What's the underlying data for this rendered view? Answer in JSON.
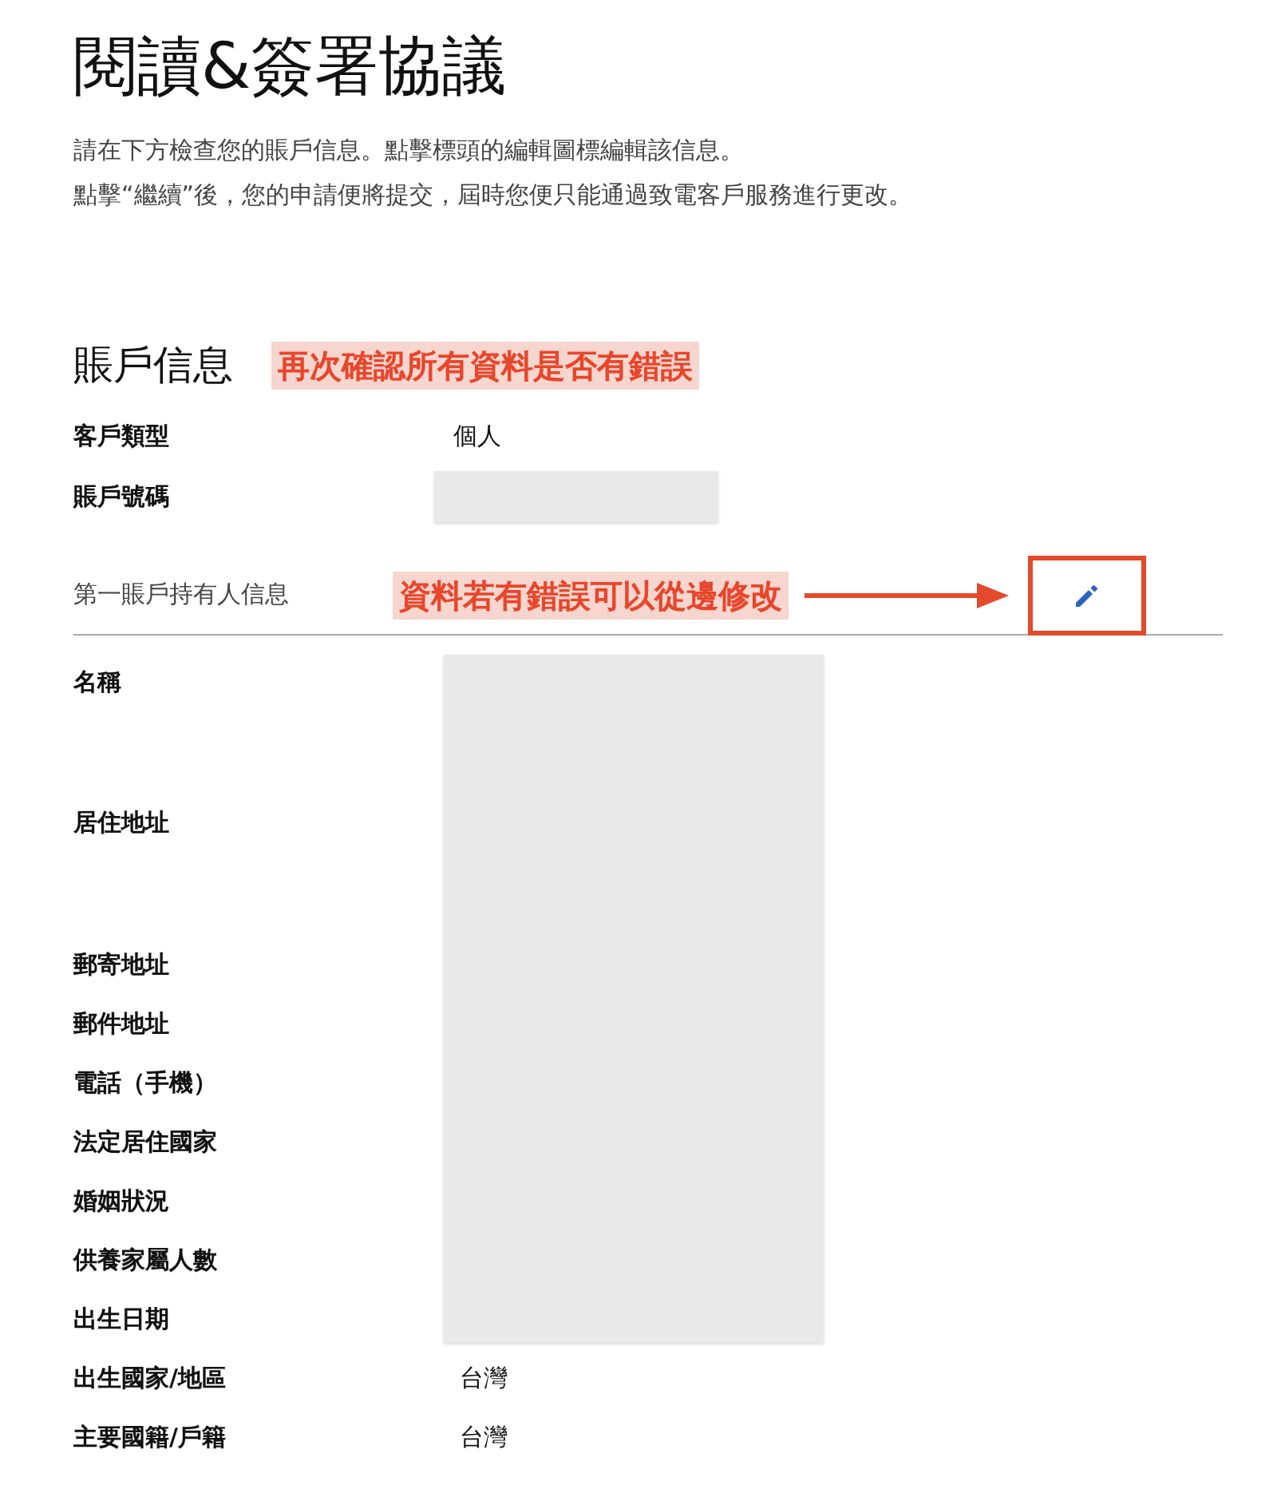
{
  "title": "閱讀&簽署協議",
  "intro": [
    "請在下方檢查您的賬戶信息。點擊標頭的編輯圖標編輯該信息。",
    "點擊“繼續”後，您的申請便將提交，屆時您便只能通過致電客戶服務進行更改。"
  ],
  "account": {
    "heading": "賬戶信息",
    "annotation": "再次確認所有資料是否有錯誤",
    "rows": [
      {
        "label": "客戶類型",
        "value": "個人",
        "redacted": false
      },
      {
        "label": "賬戶號碼",
        "redacted": true
      }
    ]
  },
  "holder": {
    "heading": "第一賬戶持有人信息",
    "annotation": "資料若有錯誤可以從邊修改",
    "edit_highlighted": true,
    "redacted": true,
    "rows": [
      {
        "label": "名稱",
        "kind": "tall"
      },
      {
        "label": "居住地址",
        "kind": "tall"
      },
      {
        "label": "郵寄地址",
        "kind": "line"
      },
      {
        "label": "郵件地址",
        "kind": "line"
      },
      {
        "label": "電話（手機）",
        "kind": "line"
      },
      {
        "label": "法定居住國家",
        "kind": "line"
      },
      {
        "label": "婚姻狀況",
        "kind": "line"
      },
      {
        "label": "供養家屬人數",
        "kind": "line"
      },
      {
        "label": "出生日期",
        "kind": "line"
      },
      {
        "label": "出生國家/地區",
        "kind": "line",
        "value": "台灣"
      },
      {
        "label": "主要國籍/戶籍",
        "kind": "line",
        "value": "台灣"
      }
    ]
  }
}
